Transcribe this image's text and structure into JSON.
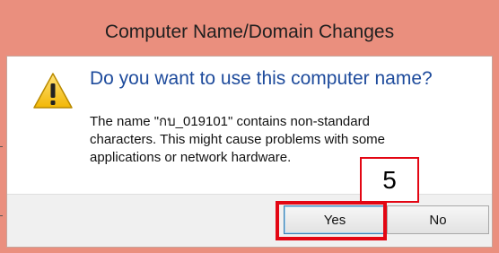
{
  "window": {
    "title": "Computer Name/Domain Changes"
  },
  "dialog": {
    "icon": "warning-icon",
    "main_instruction": "Do you want to use this computer name?",
    "content_lines": [
      "The name \"กบ_019101\" contains non-standard",
      "characters. This might cause problems with some",
      "applications or network hardware."
    ]
  },
  "buttons": {
    "yes_label": "Yes",
    "no_label": "No"
  },
  "annotation": {
    "step_number": "5",
    "highlight_color": "#e30613"
  },
  "colors": {
    "titlebar": "#ea8f7e",
    "instruction_text": "#1e4b9c"
  }
}
